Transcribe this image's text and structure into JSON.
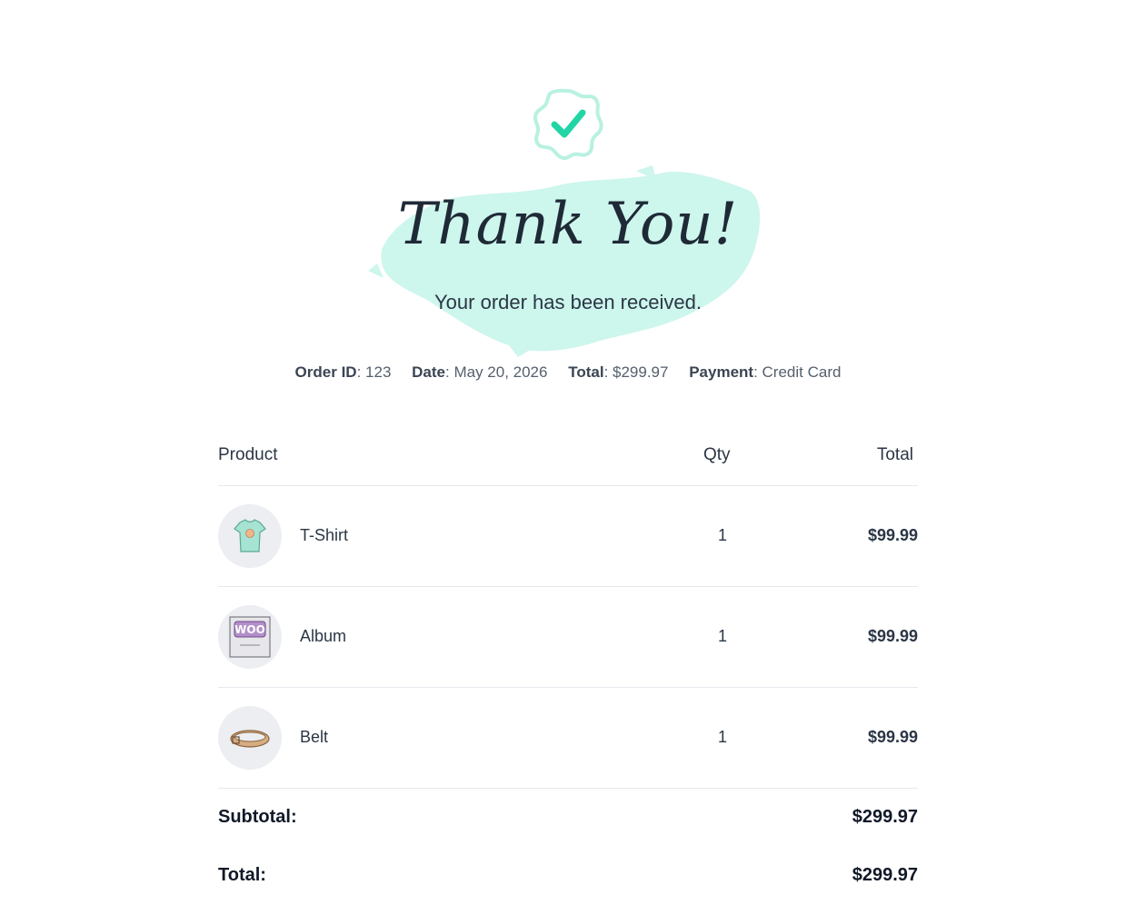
{
  "header": {
    "title": "Thank You!",
    "subtitle": "Your order has been received."
  },
  "order_meta": [
    {
      "label": "Order ID",
      "value": "123"
    },
    {
      "label": "Date",
      "value": "May 20, 2026"
    },
    {
      "label": "Total",
      "value": "$299.97"
    },
    {
      "label": "Payment",
      "value": "Credit Card"
    }
  ],
  "table": {
    "headers": {
      "product": "Product",
      "qty": "Qty",
      "total": "Total"
    },
    "rows": [
      {
        "name": "T-Shirt",
        "qty": "1",
        "total": "$99.99",
        "icon": "tshirt-icon"
      },
      {
        "name": "Album",
        "qty": "1",
        "total": "$99.99",
        "icon": "album-icon"
      },
      {
        "name": "Belt",
        "qty": "1",
        "total": "$99.99",
        "icon": "belt-icon"
      }
    ]
  },
  "totals": {
    "subtotal_label": "Subtotal:",
    "subtotal_value": "$299.97",
    "total_label": "Total:",
    "total_value": "$299.97"
  },
  "colors": {
    "accent": "#21d5a4",
    "brush": "#cdf6ec",
    "text": "#1f2a37"
  },
  "icons": {
    "badge": "check-badge-icon"
  }
}
